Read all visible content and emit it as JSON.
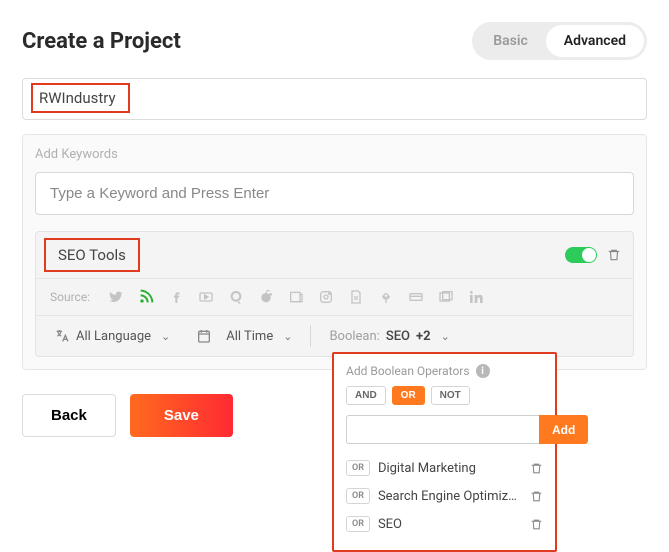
{
  "header": {
    "title": "Create a Project",
    "modes": {
      "basic": "Basic",
      "advanced": "Advanced",
      "active": "advanced"
    }
  },
  "project_name": "RWIndustry",
  "keywords_panel": {
    "label": "Add Keywords",
    "input_placeholder": "Type a Keyword and Press Enter"
  },
  "keyword_item": {
    "label": "SEO Tools",
    "toggle_on": true,
    "sources_label": "Source:",
    "filters": {
      "language": "All Language",
      "time": "All Time",
      "boolean_label": "Boolean:",
      "boolean_value": "SEO",
      "boolean_extra": "+2"
    }
  },
  "footer": {
    "back": "Back",
    "save": "Save"
  },
  "boolean_popover": {
    "title": "Add Boolean Operators",
    "ops": {
      "and": "AND",
      "or": "OR",
      "not": "NOT",
      "selected": "or"
    },
    "add_label": "Add",
    "terms": [
      {
        "op": "OR",
        "text": "Digital Marketing"
      },
      {
        "op": "OR",
        "text": "Search Engine Optimiz…"
      },
      {
        "op": "OR",
        "text": "SEO"
      }
    ]
  }
}
